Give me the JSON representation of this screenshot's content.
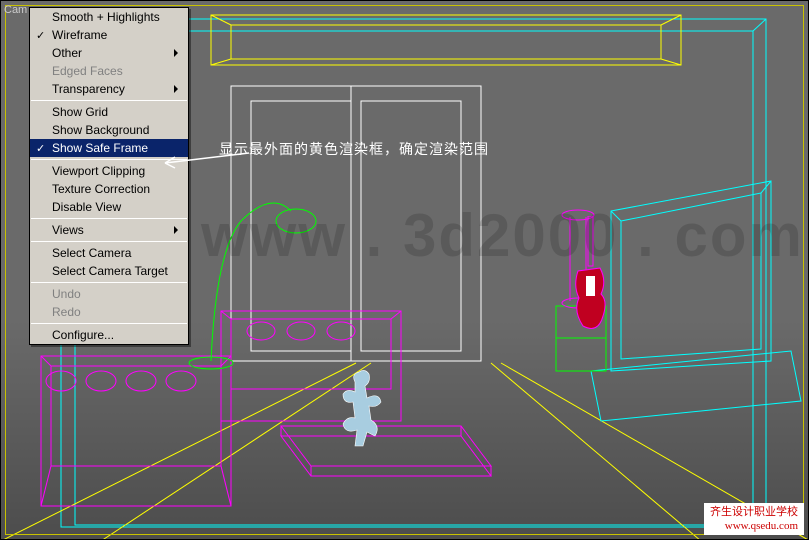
{
  "viewport_label": "Cam",
  "menu": {
    "smooth": "Smooth + Highlights",
    "wireframe": "Wireframe",
    "other": "Other",
    "edged": "Edged Faces",
    "transparency": "Transparency",
    "showgrid": "Show Grid",
    "showbg": "Show Background",
    "showsafe": "Show Safe Frame",
    "vpclip": "Viewport Clipping",
    "texcorr": "Texture Correction",
    "disable": "Disable View",
    "views": "Views",
    "selcam": "Select Camera",
    "selcamt": "Select Camera Target",
    "undo": "Undo",
    "redo": "Redo",
    "configure": "Configure..."
  },
  "annotation": "显示最外面的黄色渲染框，确定渲染范围",
  "watermark_main": "www . 3d2000 . com",
  "watermark_footer_line1": "齐生设计职业学校",
  "watermark_footer_line2": "www.qsedu.com"
}
